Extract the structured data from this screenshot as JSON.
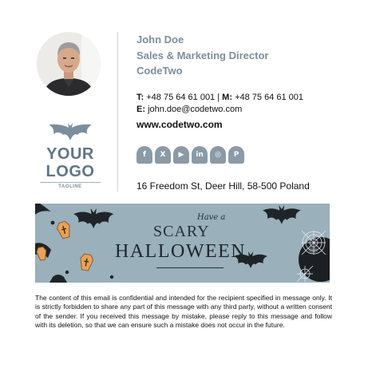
{
  "person": {
    "name": "John Doe",
    "title": "Sales & Marketing Director",
    "company": "CodeTwo"
  },
  "logo": {
    "text": "YOUR LOGO",
    "tagline": "TAGLINE"
  },
  "contact": {
    "phone_label": "T:",
    "phone": "+48 75 64 61 001",
    "separator": "|",
    "mobile_label": "M:",
    "mobile": "+48 75 64 61 001",
    "email_label": "E:",
    "email": "john.doe@codetwo.com",
    "website": "www.codetwo.com",
    "address": "16 Freedom St, Deer Hill, 58-500 Poland"
  },
  "social": [
    {
      "icon": "facebook-icon",
      "glyph": "f"
    },
    {
      "icon": "x-icon",
      "glyph": "X"
    },
    {
      "icon": "youtube-icon",
      "glyph": "▶"
    },
    {
      "icon": "linkedin-icon",
      "glyph": "in"
    },
    {
      "icon": "instagram-icon",
      "glyph": "◎"
    },
    {
      "icon": "pinterest-icon",
      "glyph": "P"
    }
  ],
  "banner": {
    "line1": "Have a",
    "line2": "SCARY",
    "line3": "HALLOWEEN"
  },
  "disclaimer": "The content of this email is confidential and intended for the recipient specified in message only. It is strictly forbidden to share any part of this message with any third party, without a written consent of the sender. If you received this message by mistake, please reply to this message and follow with its deletion, so that we can ensure such a mistake does not occur in the future.",
  "colors": {
    "accent": "#7b8e9c",
    "icon_bg": "#8a9aa7",
    "banner_bg": "#9ab0bb"
  }
}
